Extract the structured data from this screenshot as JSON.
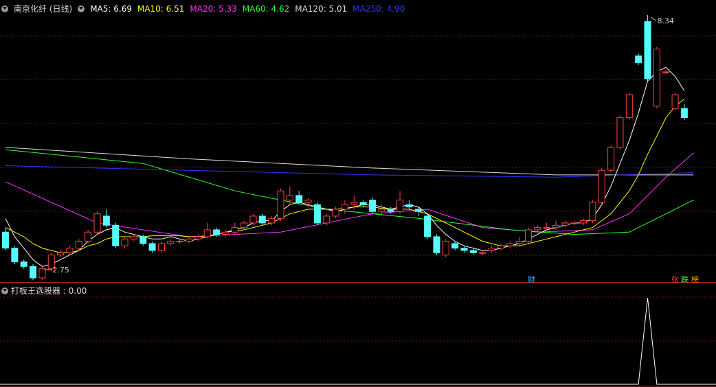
{
  "header": {
    "stock_name": "南京化纤 (日线)",
    "ma": [
      {
        "label": "MA5: 6.69",
        "color": "#ffffff"
      },
      {
        "label": "MA10: 6.51",
        "color": "#ffff00"
      },
      {
        "label": "MA20: 5.33",
        "color": "#ff33ff"
      },
      {
        "label": "MA60: 4.62",
        "color": "#33ff33"
      },
      {
        "label": "MA120: 5.01",
        "color": "#dddddd"
      },
      {
        "label": "MA250: 4.90",
        "color": "#3333ff"
      }
    ]
  },
  "indicator": {
    "label": "打板王选股器 : 0.00"
  },
  "tags": {
    "cai": "财",
    "zhang": "张",
    "die": "跌",
    "bang": "榜"
  },
  "colors": {
    "up": "#ff4444",
    "down": "#54fcfc",
    "grid": "#7a1010",
    "border": "#b22222"
  },
  "chart_data": {
    "type": "candlestick",
    "high_label": "8.34",
    "low_label": "2.75",
    "candles": [
      [
        3.6,
        3.25,
        3.7,
        3.2
      ],
      [
        3.25,
        2.95,
        3.3,
        2.9
      ],
      [
        2.95,
        2.85,
        3.0,
        2.8
      ],
      [
        2.85,
        2.6,
        2.9,
        2.55
      ],
      [
        2.6,
        2.8,
        2.85,
        2.55
      ],
      [
        2.8,
        3.1,
        3.15,
        2.75
      ],
      [
        3.1,
        3.15,
        3.2,
        3.05
      ],
      [
        3.15,
        3.25,
        3.3,
        3.1
      ],
      [
        3.25,
        3.4,
        3.45,
        3.2
      ],
      [
        3.4,
        3.6,
        3.65,
        3.35
      ],
      [
        3.6,
        4.0,
        4.05,
        3.55
      ],
      [
        3.95,
        3.75,
        4.1,
        3.7
      ],
      [
        3.75,
        3.3,
        3.8,
        3.25
      ],
      [
        3.3,
        3.45,
        3.5,
        3.25
      ],
      [
        3.45,
        3.5,
        3.55,
        3.4
      ],
      [
        3.5,
        3.35,
        3.55,
        3.3
      ],
      [
        3.35,
        3.2,
        3.4,
        3.15
      ],
      [
        3.2,
        3.35,
        3.4,
        3.15
      ],
      [
        3.35,
        3.4,
        3.45,
        3.3
      ],
      [
        3.4,
        3.4,
        3.45,
        3.35
      ],
      [
        3.4,
        3.45,
        3.5,
        3.35
      ],
      [
        3.45,
        3.5,
        3.55,
        3.4
      ],
      [
        3.5,
        3.65,
        3.8,
        3.45
      ],
      [
        3.65,
        3.55,
        3.7,
        3.5
      ],
      [
        3.55,
        3.6,
        3.65,
        3.5
      ],
      [
        3.6,
        3.7,
        3.8,
        3.55
      ],
      [
        3.7,
        3.8,
        3.85,
        3.65
      ],
      [
        3.8,
        3.95,
        4.0,
        3.75
      ],
      [
        3.95,
        3.8,
        4.0,
        3.75
      ],
      [
        3.8,
        3.9,
        3.95,
        3.75
      ],
      [
        3.9,
        4.5,
        4.55,
        3.85
      ],
      [
        4.3,
        4.4,
        4.6,
        4.2
      ],
      [
        4.4,
        4.25,
        4.5,
        4.2
      ],
      [
        4.25,
        4.3,
        4.35,
        4.15
      ],
      [
        4.2,
        3.8,
        4.25,
        3.75
      ],
      [
        3.8,
        3.95,
        4.0,
        3.75
      ],
      [
        3.95,
        4.1,
        4.15,
        3.9
      ],
      [
        4.1,
        4.2,
        4.3,
        4.0
      ],
      [
        4.2,
        4.25,
        4.4,
        4.1
      ],
      [
        4.25,
        4.2,
        4.3,
        4.15
      ],
      [
        4.3,
        4.05,
        4.35,
        4.0
      ],
      [
        4.05,
        4.1,
        4.2,
        4.0
      ],
      [
        4.1,
        4.05,
        4.15,
        4.0
      ],
      [
        4.05,
        4.3,
        4.5,
        4.0
      ],
      [
        4.2,
        4.15,
        4.3,
        4.1
      ],
      [
        4.1,
        4.05,
        4.15,
        3.95
      ],
      [
        3.95,
        3.5,
        4.0,
        3.45
      ],
      [
        3.5,
        3.15,
        3.55,
        3.1
      ],
      [
        3.1,
        3.4,
        3.45,
        3.05
      ],
      [
        3.35,
        3.25,
        3.4,
        3.2
      ],
      [
        3.25,
        3.2,
        3.3,
        3.15
      ],
      [
        3.2,
        3.15,
        3.25,
        3.1
      ],
      [
        3.15,
        3.15,
        3.2,
        3.1
      ],
      [
        3.2,
        3.25,
        3.3,
        3.15
      ],
      [
        3.25,
        3.3,
        3.35,
        3.2
      ],
      [
        3.3,
        3.35,
        3.4,
        3.25
      ],
      [
        3.35,
        3.4,
        3.5,
        3.3
      ],
      [
        3.4,
        3.65,
        3.7,
        3.35
      ],
      [
        3.65,
        3.7,
        3.75,
        3.6
      ],
      [
        3.7,
        3.7,
        3.8,
        3.65
      ],
      [
        3.7,
        3.75,
        3.85,
        3.65
      ],
      [
        3.75,
        3.8,
        3.85,
        3.7
      ],
      [
        3.8,
        3.8,
        3.85,
        3.75
      ],
      [
        3.8,
        3.85,
        3.9,
        3.75
      ],
      [
        3.85,
        4.25,
        4.3,
        3.8
      ],
      [
        4.25,
        4.95,
        5.0,
        4.2
      ],
      [
        4.95,
        5.45,
        5.5,
        4.9
      ],
      [
        5.45,
        6.1,
        6.15,
        5.4
      ],
      [
        6.1,
        6.6,
        6.65,
        6.05
      ],
      [
        7.45,
        7.3,
        7.5,
        7.25
      ],
      [
        8.2,
        6.95,
        8.34,
        6.9
      ],
      [
        6.35,
        7.6,
        7.65,
        6.3
      ],
      [
        7.1,
        7.1,
        7.15,
        7.05
      ],
      [
        6.3,
        6.6,
        6.65,
        6.25
      ],
      [
        6.3,
        6.1,
        6.4,
        6.05
      ]
    ],
    "ma_series": [
      {
        "label": "MA5",
        "color": "#ffffff",
        "values": [
          3.9,
          3.5,
          3.25,
          3.0,
          2.85,
          2.9,
          3.0,
          3.1,
          3.2,
          3.4,
          3.55,
          3.65,
          3.7,
          3.6,
          3.55,
          3.5,
          3.45,
          3.45,
          3.5,
          3.45,
          3.4,
          3.45,
          3.5,
          3.55,
          3.6,
          3.65,
          3.7,
          3.8,
          3.85,
          3.85,
          4.05,
          4.2,
          4.25,
          4.2,
          4.15,
          4.1,
          4.05,
          4.1,
          4.15,
          4.2,
          4.2,
          4.15,
          4.1,
          4.15,
          4.2,
          4.15,
          4.0,
          3.75,
          3.55,
          3.4,
          3.3,
          3.25,
          3.2,
          3.2,
          3.25,
          3.3,
          3.35,
          3.45,
          3.55,
          3.65,
          3.7,
          3.75,
          3.8,
          3.8,
          3.9,
          4.2,
          4.6,
          5.1,
          5.6,
          6.2,
          6.9,
          7.1,
          7.2,
          7.0,
          6.69
        ]
      },
      {
        "label": "MA10",
        "color": "#ffff00",
        "values": [
          3.7,
          3.6,
          3.5,
          3.35,
          3.25,
          3.2,
          3.15,
          3.15,
          3.2,
          3.3,
          3.35,
          3.45,
          3.5,
          3.5,
          3.5,
          3.5,
          3.52,
          3.52,
          3.52,
          3.52,
          3.5,
          3.5,
          3.52,
          3.55,
          3.6,
          3.62,
          3.65,
          3.7,
          3.75,
          3.8,
          3.9,
          4.0,
          4.05,
          4.1,
          4.1,
          4.1,
          4.1,
          4.12,
          4.15,
          4.15,
          4.15,
          4.12,
          4.1,
          4.1,
          4.1,
          4.05,
          4.0,
          3.9,
          3.8,
          3.7,
          3.6,
          3.5,
          3.4,
          3.35,
          3.3,
          3.3,
          3.3,
          3.35,
          3.4,
          3.45,
          3.5,
          3.55,
          3.6,
          3.65,
          3.7,
          3.85,
          4.0,
          4.25,
          4.5,
          4.85,
          5.3,
          5.7,
          6.1,
          6.35,
          6.51
        ]
      }
    ],
    "ma_smooth": [
      {
        "label": "MA20",
        "color": "#ff33ff",
        "values": [
          [
            0,
            4.7
          ],
          [
            10,
            3.8
          ],
          [
            20,
            3.5
          ],
          [
            30,
            3.6
          ],
          [
            40,
            4.0
          ],
          [
            46,
            4.1
          ],
          [
            52,
            3.7
          ],
          [
            58,
            3.6
          ],
          [
            64,
            3.65
          ],
          [
            68,
            4.0
          ],
          [
            72,
            4.8
          ],
          [
            75,
            5.33
          ]
        ]
      },
      {
        "label": "MA60",
        "color": "#33ff33",
        "values": [
          [
            0,
            5.4
          ],
          [
            15,
            5.1
          ],
          [
            25,
            4.5
          ],
          [
            35,
            4.1
          ],
          [
            45,
            3.9
          ],
          [
            55,
            3.65
          ],
          [
            62,
            3.55
          ],
          [
            68,
            3.6
          ],
          [
            72,
            4.0
          ],
          [
            75,
            4.3
          ]
        ]
      },
      {
        "label": "MA120",
        "color": "#dddddd",
        "values": [
          [
            0,
            5.45
          ],
          [
            20,
            5.2
          ],
          [
            40,
            5.0
          ],
          [
            60,
            4.85
          ],
          [
            75,
            4.85
          ]
        ]
      },
      {
        "label": "MA250",
        "color": "#3333ff",
        "values": [
          [
            0,
            5.05
          ],
          [
            20,
            4.95
          ],
          [
            40,
            4.85
          ],
          [
            60,
            4.8
          ],
          [
            75,
            4.9
          ]
        ]
      }
    ],
    "indicator": {
      "values": [
        0,
        0,
        0,
        0,
        0,
        0,
        0,
        0,
        0,
        0,
        0,
        0,
        0,
        0,
        0,
        0,
        0,
        0,
        0,
        0,
        0,
        0,
        0,
        0,
        0,
        0,
        0,
        0,
        0,
        0,
        0,
        0,
        0,
        0,
        0,
        0,
        0,
        0,
        0,
        0,
        0,
        0,
        0,
        0,
        0,
        0,
        0,
        0,
        0,
        0,
        0,
        0,
        0,
        0,
        0,
        0,
        0,
        0,
        0,
        0,
        0,
        0,
        0,
        0,
        0,
        0,
        0,
        0,
        0,
        0,
        1,
        0,
        0,
        0,
        0
      ]
    }
  }
}
